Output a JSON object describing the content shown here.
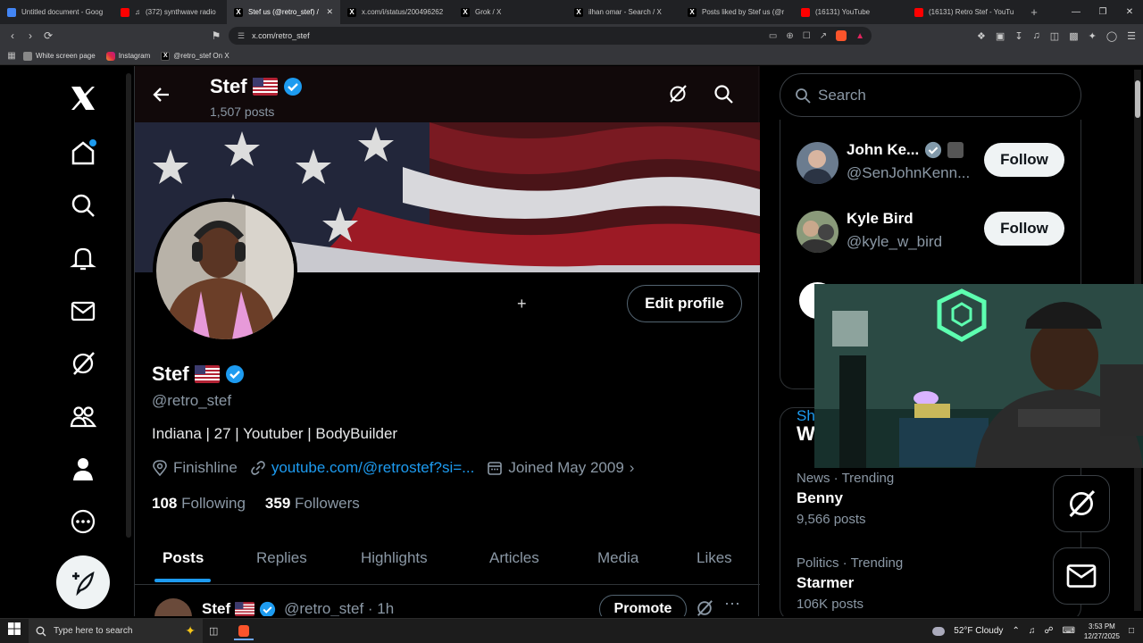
{
  "browser": {
    "tabs": [
      {
        "title": "Untitled document - Goog",
        "favicon": "docs",
        "color": "#4285f4"
      },
      {
        "title": "(372) synthwave radio",
        "favicon": "youtube",
        "color": "#ff0000",
        "audio": true
      },
      {
        "title": "Stef us (@retro_stef) /",
        "favicon": "x",
        "color": "#000000",
        "active": true
      },
      {
        "title": "x.com/i/status/200496262",
        "favicon": "x",
        "color": "#000000"
      },
      {
        "title": "Grok / X",
        "favicon": "x",
        "color": "#000000"
      },
      {
        "title": "ilhan omar - Search / X",
        "favicon": "x",
        "color": "#000000"
      },
      {
        "title": "Posts liked by Stef us (@r",
        "favicon": "x",
        "color": "#000000"
      },
      {
        "title": "(16131) YouTube",
        "favicon": "youtube",
        "color": "#ff0000"
      },
      {
        "title": "(16131) Retro Stef - YouTu",
        "favicon": "youtube",
        "color": "#ff0000"
      }
    ],
    "url": "x.com/retro_stef",
    "bookmarks": [
      {
        "label": "White screen page",
        "icon": "folder-icon"
      },
      {
        "label": "Instagram",
        "icon": "instagram-icon"
      },
      {
        "label": "@retro_stef On X",
        "icon": "x-icon"
      }
    ]
  },
  "header": {
    "name": "Stef",
    "posts": "1,507 posts"
  },
  "profile": {
    "name": "Stef",
    "handle": "@retro_stef",
    "bio": "Indiana | 27 | Youtuber | BodyBuilder",
    "location": "Finishline",
    "link": "youtube.com/@retrostef?si=...",
    "joined": "Joined May 2009",
    "following_count": "108",
    "following_label": "Following",
    "followers_count": "359",
    "followers_label": "Followers",
    "edit_label": "Edit profile"
  },
  "tabs": [
    "Posts",
    "Replies",
    "Highlights",
    "Articles",
    "Media",
    "Likes"
  ],
  "post": {
    "name": "Stef",
    "handle": "@retro_stef · 1h",
    "promote": "Promote"
  },
  "sidebar": {
    "search_placeholder": "Search",
    "who_to_follow": [
      {
        "name": "John Ke...",
        "handle": "@SenJohnKenn...",
        "follow": "Follow"
      },
      {
        "name": "Kyle Bird",
        "handle": "@kyle_w_bird",
        "follow": "Follow"
      }
    ],
    "show_more": "Sh",
    "trends_title": "W",
    "trends": [
      {
        "category": "News · Trending",
        "title": "Benny",
        "count": "9,566 posts"
      },
      {
        "category": "Politics · Trending",
        "title": "Starmer",
        "count": "106K posts"
      }
    ]
  },
  "taskbar": {
    "search_placeholder": "Type here to search",
    "weather": "52°F  Cloudy",
    "time": "3:53 PM",
    "date": "12/27/2025"
  },
  "colors": {
    "accent": "#1d9bf0",
    "background": "#000000"
  }
}
